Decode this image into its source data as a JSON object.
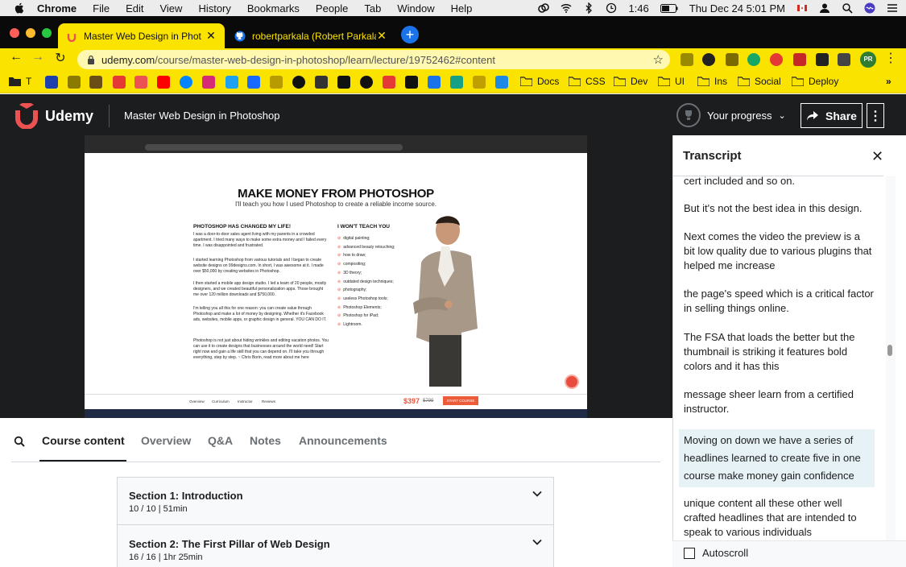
{
  "menubar": {
    "app": "Chrome",
    "items": [
      "File",
      "Edit",
      "View",
      "History",
      "Bookmarks",
      "People",
      "Tab",
      "Window",
      "Help"
    ],
    "time": "1:46",
    "datetime": "Thu Dec 24  5:01 PM"
  },
  "tabs": [
    {
      "title": "Master Web Design in Phot",
      "active": true
    },
    {
      "title": "robertparkala (Robert Parkala)",
      "active": false
    }
  ],
  "address": {
    "domain": "udemy.com",
    "path": "/course/master-web-design-in-photoshop/learn/lecture/19752462#content"
  },
  "bookmarks": {
    "first_label": "T",
    "folders": [
      "Docs",
      "CSS",
      "Dev",
      "UI",
      "Ins",
      "Social",
      "Deploy"
    ]
  },
  "header": {
    "logo": "Udemy",
    "course_title": "Master Web Design in Photoshop",
    "progress_label": "Your progress",
    "share_label": "Share"
  },
  "video": {
    "headline": "MAKE MONEY FROM PHOTOSHOP",
    "subheadline": "I'll teach you how I used Photoshop to create a reliable income source.",
    "left_heading": "PHOTOSHOP HAS CHANGED MY LIFE!",
    "paragraphs": [
      "I was a door-to-door sales agent living with my parents in a crowded apartment. I tried many ways to make some extra money and I failed every time. I was disappointed and frustrated.",
      "I started learning Photoshop from various tutorials and I began to create website designs on 99designs.com. In short, I was awesome at it. I made over $50,000 by creating websites in Photoshop.",
      "I then started a mobile app design studio. I led a team of 20 people, mostly designers, and we created beautiful personalization apps. Those brought me over 120 million downloads and $750,000.",
      "I'm telling you all this for one reason: you can create value through Photoshop and make a lot of money by designing. Whether it's Facebook ads, websites, mobile apps, or graphic design in general. YOU CAN DO IT.",
      "Photoshop is not just about hiding wrinkles and editing vacation photos. You can use it to create designs that businesses around the world need! Start right now and gain a life skill that you can depend on. I'll take you through everything, step by step. ~ Chris Borin, read more about me here"
    ],
    "right_heading": "I WON'T TEACH YOU",
    "right_list": [
      "digital painting;",
      "advanced beauty retouching;",
      "how to draw;",
      "compositing;",
      "3D theory;",
      "outdated design techniques;",
      "photography;",
      "useless Photoshop tools;",
      "Photoshop Elements;",
      "Photoshop for iPad;",
      "Lightroom."
    ],
    "price": "$397",
    "old_price": "$799",
    "cta": "START COURSE",
    "nav": [
      "Overview",
      "Curriculum",
      "Instructor",
      "Reviews"
    ]
  },
  "content_tabs": [
    "Course content",
    "Overview",
    "Q&A",
    "Notes",
    "Announcements"
  ],
  "sections": [
    {
      "title": "Section 1: Introduction",
      "meta": "10 / 10 | 51min"
    },
    {
      "title": "Section 2: The First Pillar of Web Design",
      "meta": "16 / 16 | 1hr 25min"
    }
  ],
  "transcript": {
    "title": "Transcript",
    "cues": [
      {
        "text": "cert included and so on.",
        "active": false
      },
      {
        "text": "But it's not the best idea in this design.",
        "active": false
      },
      {
        "text": "Next comes the video the preview is a bit low quality due to various plugins that helped me increase",
        "active": false
      },
      {
        "text": "the page's speed which is a critical factor in selling things online.",
        "active": false
      },
      {
        "text": "The FSA that loads the better but the thumbnail is striking it features bold colors and it has this",
        "active": false
      },
      {
        "text": "message sheer learn from a certified instructor.",
        "active": false
      },
      {
        "text": "Moving on down we have a series of headlines learned to create five in one course make money gain confidence",
        "active": true
      },
      {
        "text": "unique content all these other well crafted headlines that are intended to speak to various individuals",
        "active": false
      }
    ],
    "autoscroll_label": "Autoscroll"
  },
  "colors": {
    "chrome_theme": "#fbe300",
    "udemy_header": "#1c1d1f",
    "udemy_brand": "#a435f0",
    "active_cue": "#e6f2f5"
  }
}
